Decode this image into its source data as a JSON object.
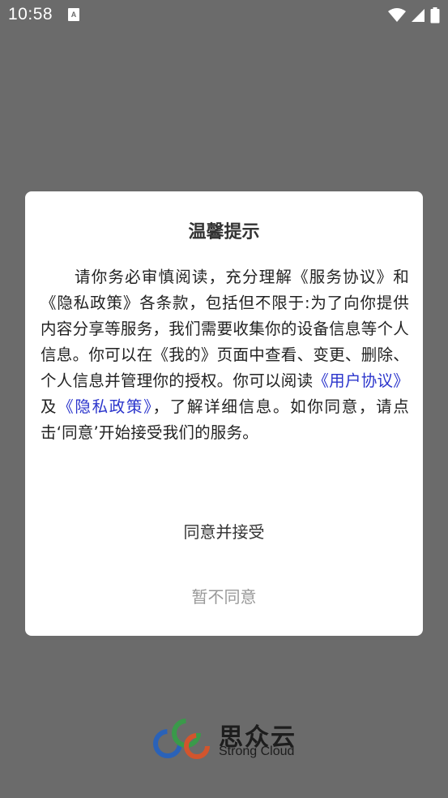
{
  "status_bar": {
    "time": "10:58",
    "icons": [
      "app-notification-icon",
      "wifi-icon",
      "signal-icon",
      "battery-icon"
    ]
  },
  "dialog": {
    "title": "温馨提示",
    "body_parts": [
      "请你务必审慎阅读，充分理解《服务协议》和《隐私政策》各条款，包括但不限于:为了向你提供内容分享等服务，我们需要收集你的设备信息等个人信息。你可以在《我的》页面中查看、变更、删除、个人信息并管理你的授权。你可以阅读",
      "《用户协议》",
      "及",
      "《隐私政策》",
      "，了解详细信息。如你同意，请点击‘同意’开始接受我们的服务。"
    ],
    "link_color": "#2b35cc",
    "agree_label": "同意并接受",
    "disagree_label": "暂不同意"
  },
  "brand": {
    "name_cn": "思众云",
    "name_en": "Strong Cloud"
  }
}
